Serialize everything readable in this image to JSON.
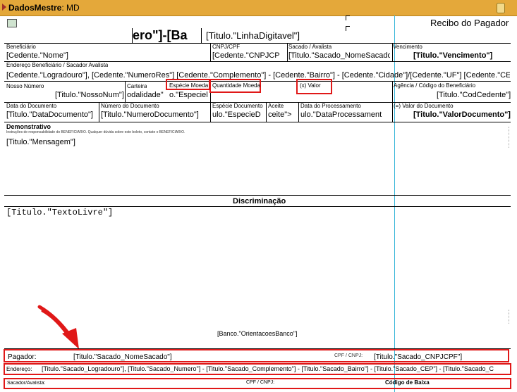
{
  "band": {
    "name": "DadosMestre",
    "dataset": "MD"
  },
  "recibo_title": "Recibo do Pagador",
  "codigo_banco": "ero\"]-[Ba",
  "linha_digitavel": "[Titulo.\"LinhaDigitavel\"]",
  "row1": {
    "beneficiario_cap": "Beneficiário",
    "beneficiario_val": "[Cedente.\"Nome\"]",
    "cpfcnpj_cap": "CNPJ/CPF",
    "cpfcnpj_val": "[Cedente.\"CNPJCP",
    "sacado_cap": "Sacado / Avalista",
    "sacado_val": "[Titulo.\"Sacado_NomeSacado",
    "venc_cap": "Vencimento",
    "venc_val": "[Titulo.\"Vencimento\"]"
  },
  "row2": {
    "endereco_cap": "Endereço Beneficiário / Sacador Avalista",
    "endereco_val": "[Cedente.\"Logradouro\"], [Cedente.\"NumeroRes\"] [Cedente.\"Complemento\"] - [Cedente.\"Bairro\"] - [Cedente.\"Cidade\"]/[Cedente.\"UF\"] [Cedente.\"CEP\"]"
  },
  "row3": {
    "nosso_cap": "Nosso Número",
    "nosso_val": "[Titulo.\"NossoNum\"]",
    "carteira_cap": "Carteira",
    "carteira_val": "odalidade\"",
    "especie_cap": "Espécie Moeda",
    "especie_val": "o.\"Especiel",
    "qtd_cap": "Quantidade Moeda",
    "valor_cap": "(x) Valor",
    "agencia_cap": "Agência / Código do Beneficiário",
    "agencia_val": "[Titulo.\"CodCedente\"]"
  },
  "row4": {
    "datadoc_cap": "Data do Documento",
    "datadoc_val": "[Titulo.\"DataDocumento\"]",
    "numdoc_cap": "Número do Documento",
    "numdoc_val": "[Titulo.\"NumeroDocumento\"]",
    "espdoc_cap": "Espécie Documento",
    "espdoc_val": "ulo.\"EspecieD",
    "aceite_cap": "Aceite",
    "aceite_val": "ceite\">",
    "dataproc_cap": "Data do Processamento",
    "dataproc_val": "ulo.\"DataProcessament",
    "valordoc_cap": "(=) Valor do Documento",
    "valordoc_val": "[Titulo.\"ValorDocumento\"]"
  },
  "demonstrativo": {
    "title": "Demonstrativo",
    "instr": "Instruções de responsabilidade do BENEFICIÁRIO. Qualquer dúvida sobre este boleto, contate o BENEFICIÁRIO.",
    "mensagem": "[Titulo.\"Mensagem\"]"
  },
  "discriminacao": {
    "title": "Discriminação",
    "texto": "[Titulo.\"TextoLivre\"]"
  },
  "orientacoes": "[Banco.\"OrientacoesBanco\"]",
  "pagador": {
    "label": "Pagador:",
    "nome": "[Titulo.\"Sacado_NomeSacado\"]",
    "cpf_cap": "CPF / CNPJ:",
    "cpf_val": "[Titulo.\"Sacado_CNPJCPF\"]",
    "endereco_cap": "Endereço:",
    "endereco_val": "[Titulo.\"Sacado_Logradouro\"], [Titulo.\"Sacado_Numero\"] - [Titulo.\"Sacado_Complemento\"] - [Titulo.\"Sacado_Bairro\"] - [Titulo.\"Sacado_CEP\"] - [Titulo.\"Sacado_C"
  },
  "sacador": {
    "label": "Sacador/Avalista:",
    "cpf_cap": "CPF / CNPJ:",
    "baixa_cap": "Código de Baixa"
  },
  "colors": {
    "band": "#e4a83a",
    "highlight": "#e01818",
    "guide": "#33b5d8"
  }
}
